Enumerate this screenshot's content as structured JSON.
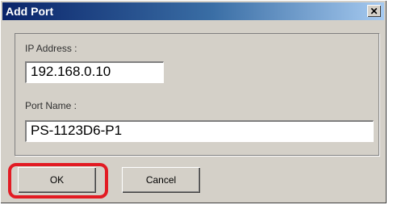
{
  "window": {
    "title": "Add Port",
    "close_glyph": "✕"
  },
  "form": {
    "ip_label": "IP Address :",
    "ip_value": "192.168.0.10",
    "port_label": "Port Name :",
    "port_value": "PS-1123D6-P1"
  },
  "buttons": {
    "ok": "OK",
    "cancel": "Cancel"
  },
  "annotation": {
    "highlight_color": "#e21b23",
    "highlight_target": "ok-button"
  }
}
